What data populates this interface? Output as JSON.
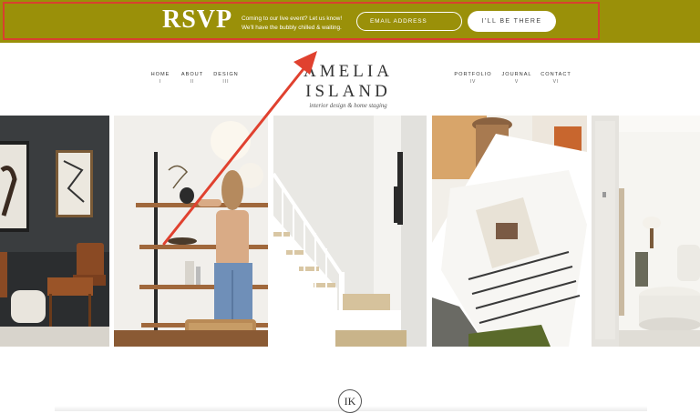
{
  "rsvp_banner": {
    "title": "RSVP",
    "message_line1": "Coming to our live event? Let us know!",
    "message_line2": "We'll have the bubbly chilled & waiting.",
    "email_placeholder": "EMAIL ADDRESS",
    "button_label": "I'LL BE THERE",
    "background_color": "#9a9009",
    "highlight_color": "#d8402f"
  },
  "nav_left": [
    {
      "label": "HOME",
      "numeral": "I"
    },
    {
      "label": "ABOUT",
      "numeral": "II"
    },
    {
      "label": "DESIGN",
      "numeral": "III"
    }
  ],
  "nav_right": [
    {
      "label": "PORTFOLIO",
      "numeral": "IV"
    },
    {
      "label": "JOURNAL",
      "numeral": "V"
    },
    {
      "label": "CONTACT",
      "numeral": "VI"
    }
  ],
  "logo": {
    "title": "AMELIA ISLAND",
    "tagline": "interior design & home staging"
  },
  "monogram": {
    "text": "IK"
  },
  "annotation": {
    "arrow_color": "#e0412f"
  }
}
